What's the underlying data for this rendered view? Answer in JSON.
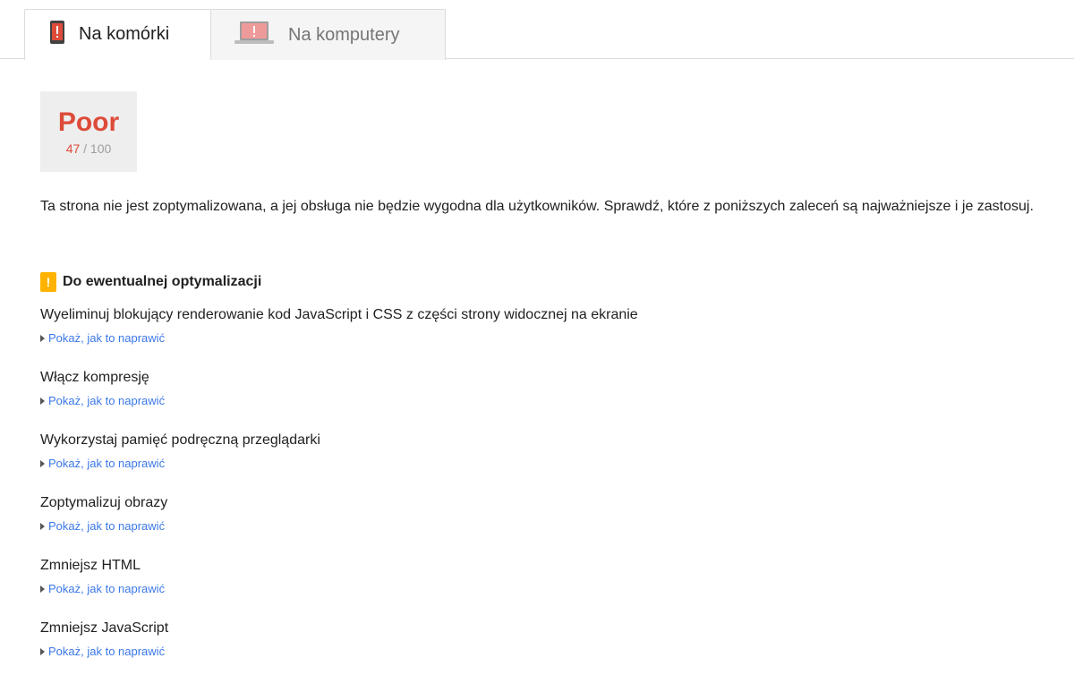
{
  "tabs": [
    {
      "label": "Na komórki",
      "icon": "mobile-phone-warning-icon",
      "active": true
    },
    {
      "label": "Na komputery",
      "icon": "laptop-warning-icon",
      "active": false
    }
  ],
  "score": {
    "label": "Poor",
    "value": "47",
    "max": " / 100"
  },
  "summary": "Ta strona nie jest zoptymalizowana, a jej obsługa nie będzie wygodna dla użytkowników. Sprawdź, które z poniższych zaleceń są najważniejsze i je zastosuj.",
  "section": {
    "badge": "!",
    "title": "Do ewentualnej optymalizacji"
  },
  "items": [
    {
      "title": "Wyeliminuj blokujący renderowanie kod JavaScript i CSS z części strony widocznej na ekranie",
      "link": "Pokaż, jak to naprawić"
    },
    {
      "title": "Włącz kompresję",
      "link": "Pokaż, jak to naprawić"
    },
    {
      "title": "Wykorzystaj pamięć podręczną przeglądarki",
      "link": "Pokaż, jak to naprawić"
    },
    {
      "title": "Zoptymalizuj obrazy",
      "link": "Pokaż, jak to naprawić"
    },
    {
      "title": "Zmniejsz HTML",
      "link": "Pokaż, jak to naprawić"
    },
    {
      "title": "Zmniejsz JavaScript",
      "link": "Pokaż, jak to naprawić"
    }
  ],
  "colors": {
    "poor": "#dd4b39",
    "warning": "#ffb300",
    "link": "#3b78e7"
  }
}
